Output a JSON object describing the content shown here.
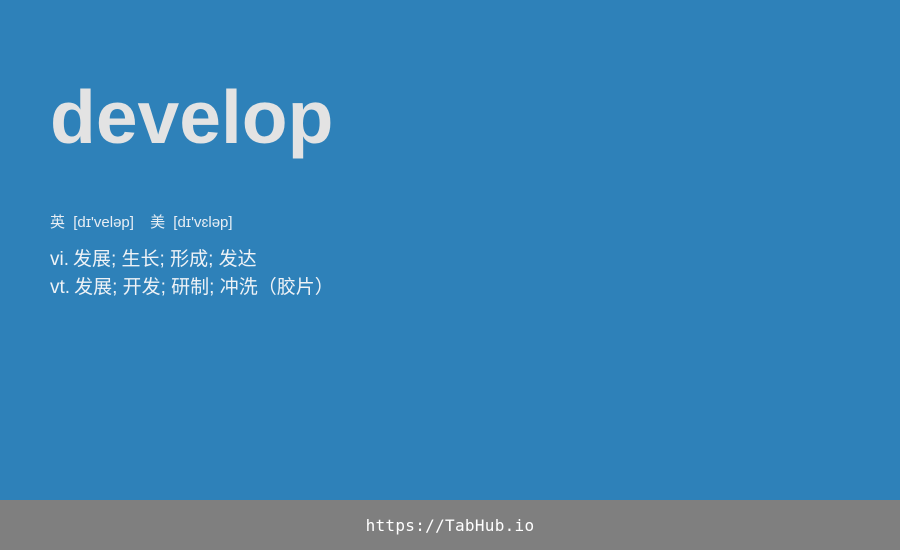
{
  "word": "develop",
  "phonetics": [
    {
      "region": "英",
      "ipa": "[dɪ'veləp]"
    },
    {
      "region": "美",
      "ipa": "[dɪ'vɛləp]"
    }
  ],
  "definitions": [
    {
      "pos": "vi.",
      "meaning": "发展; 生长; 形成; 发达"
    },
    {
      "pos": "vt.",
      "meaning": "发展; 开发; 研制; 冲洗（胶片）"
    }
  ],
  "footer": {
    "link_text": "https://TabHub.io"
  },
  "colors": {
    "background": "#2e81b9",
    "word": "#e3e3e3",
    "footer_bar": "#7f7f7f",
    "footer_text": "#ffffff"
  }
}
